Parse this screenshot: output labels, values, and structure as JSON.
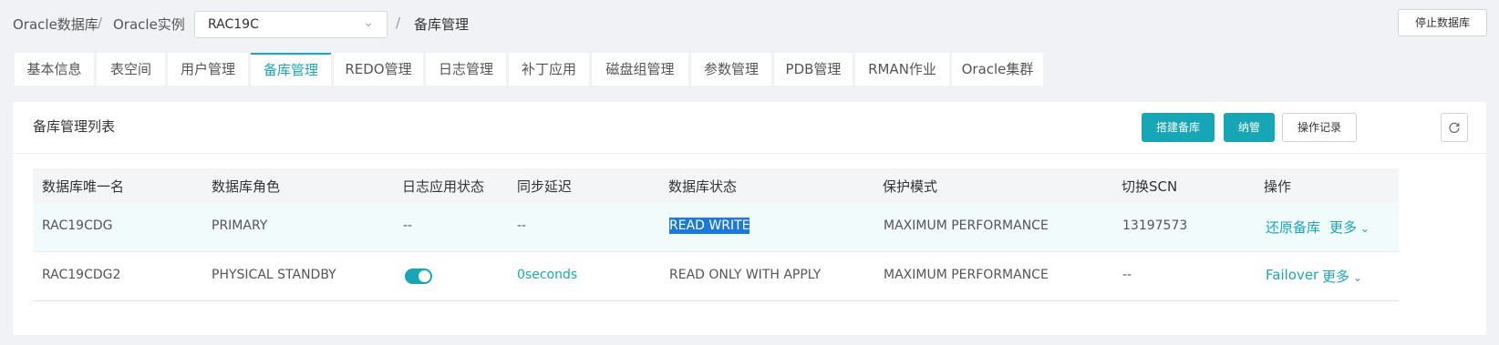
{
  "breadcrumb": {
    "root": "Oracle数据库",
    "level2": "Oracle实例",
    "instance_value": "RAC19C",
    "current": "备库管理",
    "separator": "/"
  },
  "header": {
    "stop_db_label": "停止数据库"
  },
  "tabs": [
    {
      "label": "基本信息"
    },
    {
      "label": "表空间"
    },
    {
      "label": "用户管理"
    },
    {
      "label": "备库管理",
      "active": true
    },
    {
      "label": "REDO管理"
    },
    {
      "label": "日志管理"
    },
    {
      "label": "补丁应用"
    },
    {
      "label": "磁盘组管理"
    },
    {
      "label": "参数管理"
    },
    {
      "label": "PDB管理"
    },
    {
      "label": "RMAN作业"
    },
    {
      "label": "Oracle集群"
    }
  ],
  "panel": {
    "title": "备库管理列表",
    "buttons": {
      "build_standby": "搭建备库",
      "manage": "纳管",
      "op_records": "操作记录"
    }
  },
  "table": {
    "columns": [
      "数据库唯一名",
      "数据库角色",
      "日志应用状态",
      "同步延迟",
      "数据库状态",
      "保护模式",
      "切换SCN",
      "操作"
    ],
    "rows": [
      {
        "unique_name": "RAC19CDG",
        "role": "PRIMARY",
        "log_apply": "--",
        "sync_delay": "--",
        "db_status": "READ WRITE",
        "protection_mode": "MAXIMUM PERFORMANCE",
        "switch_scn": "13197573",
        "action_primary": "还原备库",
        "action_more": "更多"
      },
      {
        "unique_name": "RAC19CDG2",
        "role": "PHYSICAL STANDBY",
        "log_apply_on": true,
        "sync_delay": "0seconds",
        "db_status": "READ ONLY WITH APPLY",
        "protection_mode": "MAXIMUM PERFORMANCE",
        "switch_scn": "--",
        "action_primary": "Failover",
        "action_more": "更多"
      }
    ]
  },
  "colors": {
    "accent": "#1ba7b5",
    "selection": "#1b79d9",
    "background": "#f0f2f5"
  },
  "icons": [
    "chevron-down-icon",
    "refresh-icon",
    "toggle-switch"
  ]
}
